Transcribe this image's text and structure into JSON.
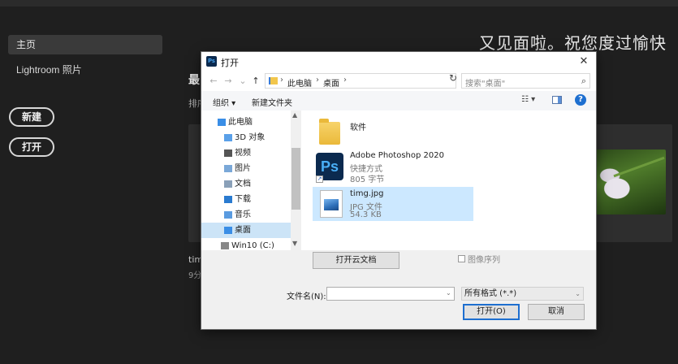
{
  "background": {
    "nav_home": "主页",
    "nav_lightroom": "Lightroom 照片",
    "new_button": "新建",
    "open_button": "打开",
    "welcome": "又见面啦。祝您度过愉快",
    "recent_title": "最",
    "sort_label": "排序",
    "recent_file_name": "tim",
    "recent_file_time": "9分"
  },
  "dialog": {
    "ps_icon": "Ps",
    "title": "打开",
    "close": "✕",
    "nav": {
      "back": "←",
      "forward": "→",
      "down": "⌄",
      "up": "↑"
    },
    "path": [
      "此电脑",
      "桌面"
    ],
    "path_sep": "›",
    "search_placeholder": "搜索\"桌面\"",
    "toolbar": {
      "organize": "组织 ▾",
      "new_folder": "新建文件夹",
      "view": "☷ ▾",
      "help": "?"
    },
    "tree": [
      {
        "label": "此电脑",
        "icon": "computer-icon",
        "color": "#3a8ee6"
      },
      {
        "label": "3D 对象",
        "icon": "cube-icon",
        "color": "#5aa0e8"
      },
      {
        "label": "视频",
        "icon": "video-icon",
        "color": "#555"
      },
      {
        "label": "图片",
        "icon": "pictures-icon",
        "color": "#7aa8d8"
      },
      {
        "label": "文档",
        "icon": "document-icon",
        "color": "#8aa0b8"
      },
      {
        "label": "下载",
        "icon": "download-icon",
        "color": "#2a7bd0"
      },
      {
        "label": "音乐",
        "icon": "music-icon",
        "color": "#5a9be0"
      },
      {
        "label": "桌面",
        "icon": "desktop-icon",
        "color": "#3a8ee6"
      },
      {
        "label": "Win10 (C:)",
        "icon": "drive-icon",
        "color": "#888"
      }
    ],
    "selected_tree_index": 7,
    "files": [
      {
        "name": "软件",
        "type": "folder"
      },
      {
        "name": "Adobe Photoshop 2020",
        "meta1": "快捷方式",
        "meta2": "805 字节",
        "icon_text": "Ps",
        "shortcut": "↗"
      },
      {
        "name": "timg.jpg",
        "meta1": "JPG 文件",
        "meta2": "54.3 KB"
      }
    ],
    "cloud_button": "打开云文档",
    "image_sequence_label": "图像序列",
    "filename_label": "文件名(N):",
    "filename_value": "",
    "filetype_value": "所有格式 (*.*)",
    "open_button": "打开(O)",
    "cancel_button": "取消",
    "accent": "#1e6fd0",
    "selection_color": "#cce8ff"
  }
}
